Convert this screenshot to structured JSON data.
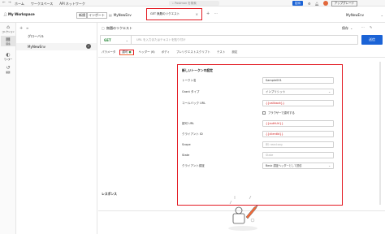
{
  "topbar": {
    "items": [
      "ホーム",
      "ワークスペース",
      "API ネットワーク"
    ],
    "search_placeholder": "Postman を検索",
    "invite_label": "招待",
    "upgrade_label": "アップグレード"
  },
  "workspace": {
    "title": "My Workspace",
    "new_label": "新規",
    "import_label": "インポート"
  },
  "request_tabs": [
    {
      "label": "MyNewEnv"
    },
    {
      "label": "GET 無題のリクエスト",
      "active": true
    }
  ],
  "env_selector": {
    "value": "MyNewEnv"
  },
  "sidebar_icons": [
    {
      "label": "コレクション"
    },
    {
      "label": "環境"
    },
    {
      "label": "モニター"
    },
    {
      "label": "履歴"
    }
  ],
  "sidebar_panel": {
    "items": [
      {
        "label": "グローバル"
      },
      {
        "label": "MyNewEnv",
        "checked": true
      }
    ]
  },
  "request": {
    "title": "無題のリクエスト",
    "save_label": "保存",
    "method": "GET",
    "url_placeholder": "URL を入力またはテキストを貼り付け",
    "send_label": "送信",
    "tabs": [
      "パラメータ",
      "認可",
      "ヘッダー (6)",
      "ボディ",
      "プレリクエストスクリプト",
      "テスト",
      "設定"
    ],
    "active_tab": "認可"
  },
  "token_form": {
    "heading": "新しいトークンの設定",
    "token_name_label": "トークン名",
    "token_name_value": "Sample001",
    "grant_type_label": "Grant タイプ",
    "grant_type_value": "インプリシット",
    "callback_url_label": "コールバック URL",
    "callback_url_value": "{{callback}}",
    "browser_auth_label": "ブラウザーで認可する",
    "auth_url_label": "認可 URL",
    "auth_url_value": "{{authUrl}}",
    "client_id_label": "クライアント ID",
    "client_id_value": "{{clientId}}",
    "scope_label": "Scope",
    "scope_placeholder": "例: read:org",
    "state_label": "State",
    "state_placeholder": "State",
    "client_auth_label": "クライアント認証",
    "client_auth_value": "Basic 認証ヘッダーとして送信"
  },
  "response": {
    "label": "レスポンス"
  },
  "colors": {
    "highlight": "#e31b23",
    "accent": "#f26b3a",
    "primary": "#1b63d6"
  }
}
